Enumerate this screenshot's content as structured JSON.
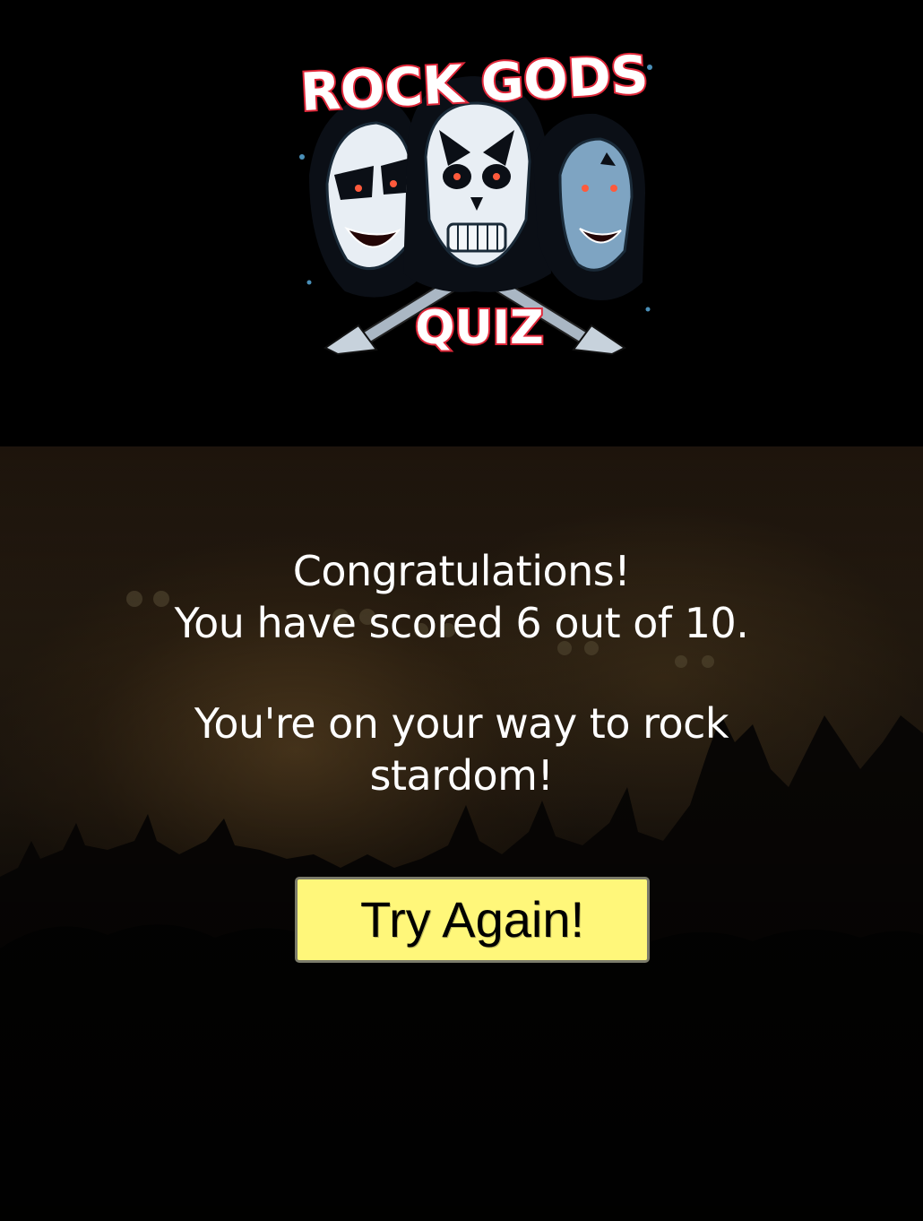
{
  "logo": {
    "title_top": "ROCK GODS",
    "title_bottom": "QUIZ",
    "colors": {
      "outline": "#e0283a",
      "skin": "#ffffff",
      "hair": "#0b0f16",
      "accent": "#4a8fb8"
    }
  },
  "result": {
    "heading": "Congratulations!",
    "score_text": "You have scored 6 out of 10.",
    "score": 6,
    "total": 10,
    "message": "You're on your way to rock stardom!"
  },
  "actions": {
    "try_again_label": "Try Again!",
    "button_color": "#fff77a"
  }
}
